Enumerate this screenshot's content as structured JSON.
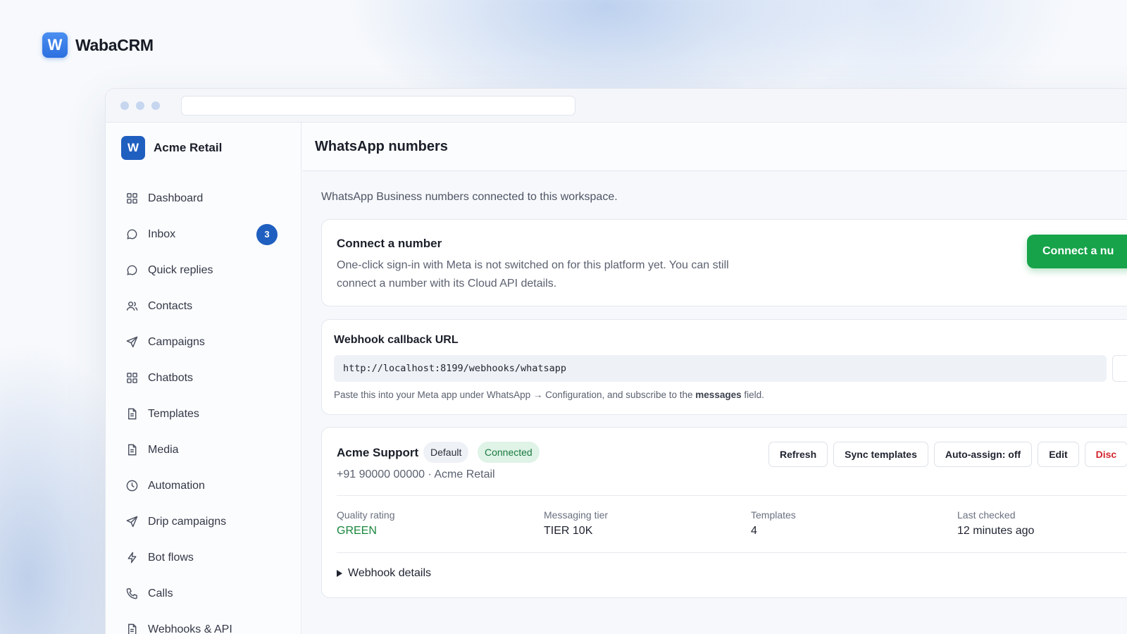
{
  "brand": {
    "logo_letter": "W",
    "name": "WabaCRM"
  },
  "workspace": {
    "logo_letter": "W",
    "name": "Acme Retail"
  },
  "sidebar": {
    "items": [
      {
        "label": "Dashboard",
        "icon": "grid-icon"
      },
      {
        "label": "Inbox",
        "icon": "chat-icon",
        "badge": "3"
      },
      {
        "label": "Quick replies",
        "icon": "chat-icon"
      },
      {
        "label": "Contacts",
        "icon": "users-icon"
      },
      {
        "label": "Campaigns",
        "icon": "send-icon"
      },
      {
        "label": "Chatbots",
        "icon": "grid-icon"
      },
      {
        "label": "Templates",
        "icon": "document-icon"
      },
      {
        "label": "Media",
        "icon": "document-icon"
      },
      {
        "label": "Automation",
        "icon": "clock-icon"
      },
      {
        "label": "Drip campaigns",
        "icon": "send-icon"
      },
      {
        "label": "Bot flows",
        "icon": "bolt-icon"
      },
      {
        "label": "Calls",
        "icon": "phone-icon"
      },
      {
        "label": "Webhooks & API",
        "icon": "document-icon"
      }
    ]
  },
  "page": {
    "title": "WhatsApp numbers",
    "subtitle": "WhatsApp Business numbers connected to this workspace."
  },
  "connect_card": {
    "title": "Connect a number",
    "description": "One-click sign-in with Meta is not switched on for this platform yet. You can still connect a number with its Cloud API details.",
    "button_label": "Connect a nu"
  },
  "webhook_card": {
    "title": "Webhook callback URL",
    "url": "http://localhost:8199/webhooks/whatsapp",
    "hint_before": "Paste this into your Meta app under WhatsApp → Configuration, and subscribe to the ",
    "hint_bold": "messages",
    "hint_after": " field."
  },
  "number_card": {
    "name": "Acme Support",
    "pill_default": "Default",
    "pill_status": "Connected",
    "phone_line": "+91 90000 00000 · Acme Retail",
    "actions": {
      "refresh": "Refresh",
      "sync": "Sync templates",
      "auto_assign": "Auto-assign: off",
      "edit": "Edit",
      "disconnect": "Disc"
    },
    "stats": {
      "quality_label": "Quality rating",
      "quality_value": "GREEN",
      "tier_label": "Messaging tier",
      "tier_value": "TIER 10K",
      "templates_label": "Templates",
      "templates_value": "4",
      "checked_label": "Last checked",
      "checked_value": "12 minutes ago"
    },
    "details_label": "Webhook details"
  },
  "colors": {
    "accent": "#1f5fbf",
    "green": "#17a34a",
    "danger": "#d3262e"
  }
}
